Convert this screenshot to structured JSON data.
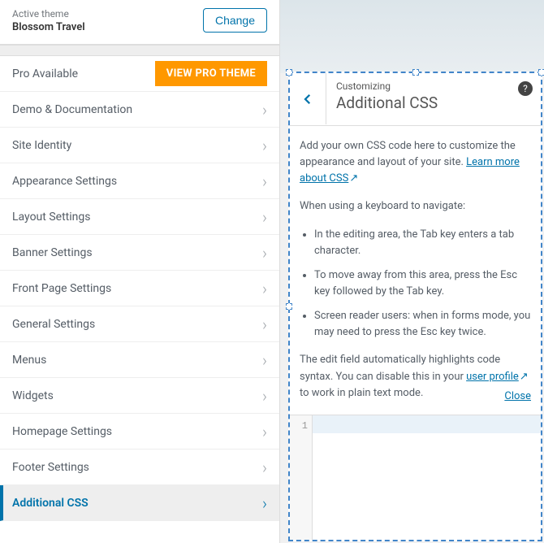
{
  "theme": {
    "active_label": "Active theme",
    "name": "Blossom Travel",
    "change_label": "Change"
  },
  "sidebar": {
    "pro": {
      "label": "Pro Available",
      "badge": "VIEW PRO THEME"
    },
    "items": [
      {
        "label": "Demo & Documentation"
      },
      {
        "label": "Site Identity"
      },
      {
        "label": "Appearance Settings"
      },
      {
        "label": "Layout Settings"
      },
      {
        "label": "Banner Settings"
      },
      {
        "label": "Front Page Settings"
      },
      {
        "label": "General Settings"
      },
      {
        "label": "Menus"
      },
      {
        "label": "Widgets"
      },
      {
        "label": "Homepage Settings"
      },
      {
        "label": "Footer Settings"
      },
      {
        "label": "Additional CSS"
      }
    ]
  },
  "detail": {
    "customizing": "Customizing",
    "title": "Additional CSS",
    "intro_part1": "Add your own CSS code here to customize the appearance and layout of your site. ",
    "learn_more_label": "Learn more about CSS",
    "keyboard_heading": "When using a keyboard to navigate:",
    "bullets": [
      "In the editing area, the Tab key enters a tab character.",
      "To move away from this area, press the Esc key followed by the Tab key.",
      "Screen reader users: when in forms mode, you may need to press the Esc key twice."
    ],
    "syntax_part1": "The edit field automatically highlights code syntax. You can disable this in your ",
    "user_profile_label": "user profile",
    "syntax_part2": " to work in plain text mode.",
    "close_label": "Close",
    "line_number": "1"
  }
}
